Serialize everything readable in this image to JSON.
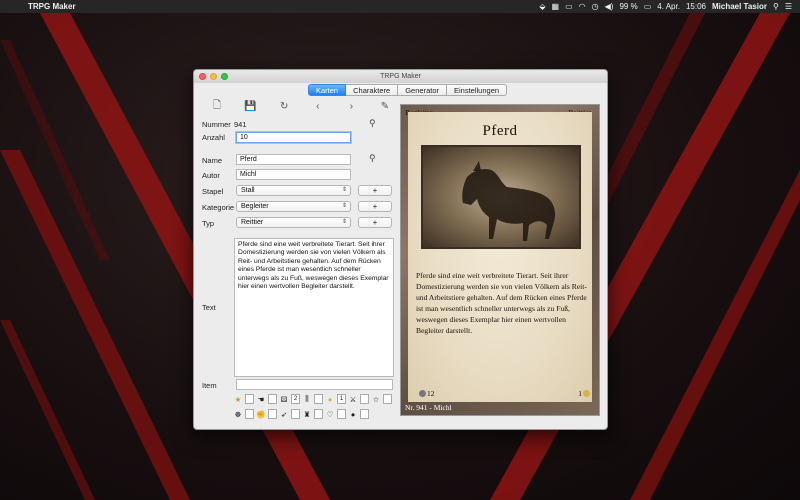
{
  "menubar": {
    "apple": "",
    "app_name": "TRPG Maker",
    "battery": "99 %",
    "date": "4. Apr.",
    "time": "15:06",
    "user": "Michael Tasior"
  },
  "window": {
    "title": "TRPG Maker",
    "tabs": [
      {
        "label": "Karten",
        "active": true
      },
      {
        "label": "Charaktere",
        "active": false
      },
      {
        "label": "Generator",
        "active": false
      },
      {
        "label": "Einstellungen",
        "active": false
      }
    ]
  },
  "toolbar": {
    "icons": [
      "new-card-icon",
      "save-icon",
      "refresh-icon",
      "previous-icon",
      "next-icon",
      "edit-icon"
    ]
  },
  "form": {
    "nummer_label": "Nummer",
    "nummer_value": "941",
    "anzahl_label": "Anzahl",
    "anzahl_value": "10",
    "name_label": "Name",
    "name_value": "Pferd",
    "autor_label": "Autor",
    "autor_value": "Michl",
    "stapel_label": "Stapel",
    "stapel_value": "Stall",
    "kategorie_label": "Kategorie",
    "kategorie_value": "Begleiter",
    "typ_label": "Typ",
    "typ_value": "Reittier",
    "plus_label": "+",
    "text_label": "Text",
    "text_value": "Pferde sind eine weit verbreitete Tierart. Seit ihrer Domestizierung werden sie von vielen Völkern als Reit- und Arbeitstiere gehalten. Auf dem Rücken eines Pferde ist man wesentlich schneller unterwegs als zu Fuß, weswegen dieses Exemplar hier einen wertvollen Begleiter darstellt.",
    "item_label": "Item",
    "item_value": ""
  },
  "symbols": {
    "row1": [
      {
        "icon": "star-icon",
        "glyph": "★",
        "value": ""
      },
      {
        "icon": "glove-icon",
        "glyph": "☚",
        "value": ""
      },
      {
        "icon": "dice-icon",
        "glyph": "⚄",
        "value": "2"
      },
      {
        "icon": "chart-icon",
        "glyph": "⫼",
        "value": ""
      },
      {
        "icon": "coin-icon",
        "glyph": "●",
        "value": "1"
      },
      {
        "icon": "crossed-swords-icon",
        "glyph": "⚔",
        "value": ""
      },
      {
        "icon": "star-outline-icon",
        "glyph": "☆",
        "value": ""
      }
    ],
    "row2": [
      {
        "icon": "bug-icon",
        "glyph": "☸",
        "value": ""
      },
      {
        "icon": "fist-icon",
        "glyph": "✊",
        "value": ""
      },
      {
        "icon": "wing-icon",
        "glyph": "➶",
        "value": ""
      },
      {
        "icon": "shirt-icon",
        "glyph": "♜",
        "value": ""
      },
      {
        "icon": "heart-icon",
        "glyph": "♡",
        "value": ""
      },
      {
        "icon": "bomb-icon",
        "glyph": "●",
        "value": ""
      }
    ]
  },
  "card": {
    "category": "Begleiter",
    "type": "Reittier",
    "title": "Pferd",
    "text": "Pferde sind eine weit verbreitete Tierart. Seit ihrer Domestizierung werden sie von vielen Völkern als Reit- und Arbeitstiere gehalten. Auf dem Rücken eines Pferde ist man wesentlich schneller unterwegs als zu Fuß, weswegen dieses Exemplar hier einen wertvollen Begleiter darstellt.",
    "cost": "12",
    "gold": "1",
    "footer": "Nr. 941 - Michl"
  }
}
